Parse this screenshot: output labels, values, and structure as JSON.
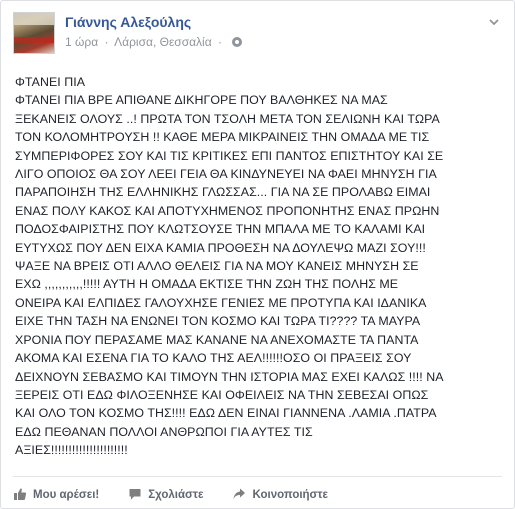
{
  "post": {
    "author": "Γιάννης Αλεξούλης",
    "time": "1 ώρα",
    "location": "Λάρισα, Θεσσαλία",
    "separator": "·",
    "privacy_icon": "globe-icon",
    "options_icon": "chevron-down-icon",
    "text": "ΦΤΑΝΕΙ ΠΙΑ\nΦΤΑΝΕΙ ΠΙΑ ΒΡΕ ΑΠΙΘΑΝΕ ΔΙΚΗΓΟΡΕ ΠΟΥ ΒΑΛΘΗΚΕΣ ΝΑ ΜΑΣ\nΞΕΚΑΝΕΙΣ ΟΛΟΥΣ ..! ΠΡΩΤΑ ΤΟΝ ΤΣΟΛΗ ΜΕΤΑ ΤΟΝ ΣΕΛΙΩΝΗ ΚΑΙ ΤΩΡΑ\nΤΟΝ ΚΟΛΟΜΗΤΡΟΥΣΗ !! ΚΑΘΕ ΜΕΡΑ ΜΙΚΡΑΙΝΕΙΣ ΤΗΝ ΟΜΑΔΑ ΜΕ ΤΙΣ\nΣΥΜΠΕΡΙΦΟΡΕΣ ΣΟΥ ΚΑΙ ΤΙΣ ΚΡΙΤΙΚΕΣ ΕΠΙ ΠΑΝΤΟΣ ΕΠΙΣΤΗΤΟΥ ΚΑΙ ΣΕ\nΛΙΓΟ ΟΠΟΙΟΣ ΘΑ ΣΟΥ ΛΕΕΙ ΓΕΙΑ ΘΑ ΚΙΝΔΥΝΕΥΕΙ ΝΑ ΦΑΕΙ ΜΗΝΥΣΗ ΓΙΑ\nΠΑΡΑΠΟΙΗΣΗ ΤΗΣ ΕΛΛΗΝΙΚΗΣ ΓΛΩΣΣΑΣ... ΓΙΑ ΝΑ ΣΕ ΠΡΟΛΑΒΩ ΕΙΜΑΙ\nΕΝΑΣ ΠΟΛΥ ΚΑΚΟΣ ΚΑΙ ΑΠΟΤΥΧΗΜΕΝΟΣ ΠΡΟΠΟΝΗΤΗΣ ΕΝΑΣ ΠΡΩΗΝ\nΠΟΔΟΣΦΑΙΡΙΣΤΗΣ ΠΟΥ ΚΛΩΤΣΟΥΣΕ ΤΗΝ ΜΠΑΛΑ ΜΕ ΤΟ ΚΑΛΑΜΙ ΚΑΙ\nΕΥΤΥΧΩΣ ΠΟΥ ΔΕΝ ΕΙΧΑ ΚΑΜΙΑ ΠΡΟΘΕΣΗ ΝΑ ΔΟΥΛΕΨΩ ΜΑΖΙ ΣΟΥ!!!\nΨΑΞΕ ΝΑ ΒΡΕΙΣ ΟΤΙ ΑΛΛΟ ΘΕΛΕΙΣ ΓΙΑ ΝΑ ΜΟΥ ΚΑΝΕΙΣ ΜΗΝΥΣΗ ΣΕ\nΕΧΩ ,,,,,,,,,,,!!!!! ΑΥΤΗ Η ΟΜΑΔΑ ΕΚΤΙΣΕ ΤΗΝ ΖΩΗ ΤΗΣ ΠΟΛΗΣ ΜΕ\nΟΝΕΙΡΑ ΚΑΙ ΕΛΠΙΔΕΣ ΓΑΛΟΥΧΗΣΕ ΓΕΝΙΕΣ ΜΕ ΠΡΟΤΥΠΑ ΚΑΙ ΙΔΑΝΙΚΑ\nΕΙΧΕ ΤΗΝ ΤΑΣΗ ΝΑ ΕΝΩΝΕΙ ΤΟΝ ΚΟΣΜΟ ΚΑΙ ΤΩΡΑ ΤΙ???? ΤΑ ΜΑΥΡΑ\nΧΡΟΝΙΑ ΠΟΥ ΠΕΡΑΣΑΜΕ ΜΑΣ ΚΑΝΑΝΕ ΝΑ ΑΝΕΧΟΜΑΣΤΕ ΤΑ ΠΑΝΤΑ\nΑΚΟΜΑ ΚΑΙ ΕΣΕΝΑ ΓΙΑ ΤΟ ΚΑΛΟ ΤΗΣ ΑΕΛ!!!!!!ΟΣΟ ΟΙ ΠΡΑΞΕΙΣ ΣΟΥ\nΔΕΙΧΝΟΥΝ ΣΕΒΑΣΜΟ ΚΑΙ ΤΙΜΟΥΝ ΤΗΝ ΙΣΤΟΡΙΑ ΜΑΣ ΕΧΕΙ ΚΑΛΩΣ !!!! ΝΑ\nΞΕΡΕΙΣ ΟΤΙ ΕΔΩ ΦΙΛΟΞΕΝΗΣΕ ΚΑΙ ΟΦΕΙΛΕΙΣ ΝΑ ΤΗΝ ΣΕΒΕΣΑΙ ΟΠΩΣ\nΚΑΙ ΟΛΟ ΤΟΝ ΚΟΣΜΟ ΤΗΣ!!!! ΕΔΩ ΔΕΝ ΕΙΝΑΙ ΓΙΑΝΝΕΝΑ .ΛΑΜΙΑ .ΠΑΤΡΑ\nΕΔΩ ΠΕΘΑΝΑΝ ΠΟΛΛΟΙ ΑΝΘΡΩΠΟΙ ΓΙΑ ΑΥΤΕΣ ΤΙΣ\nΑΞΙΕΣ!!!!!!!!!!!!!!!!!!!!!!"
  },
  "actions": {
    "like_label": "Μου αρέσει!",
    "comment_label": "Σχολιάστε",
    "share_label": "Κοινοποιήστε",
    "icon_color": "#616770",
    "link_color": "#365899"
  }
}
